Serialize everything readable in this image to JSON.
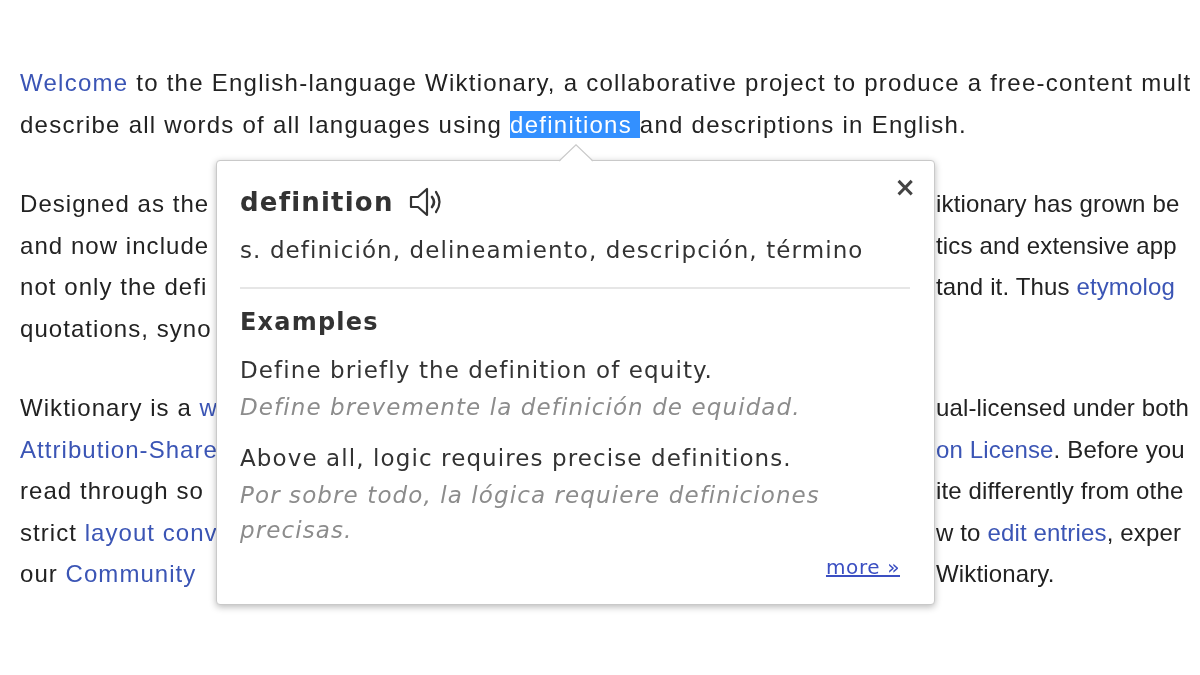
{
  "article": {
    "paragraphs": [
      {
        "lines": [
          {
            "kind": "whole",
            "left": [
              {
                "kind": "link",
                "text": "Welcome"
              },
              {
                "kind": "plain",
                "text": " to the English-language Wiktionary, a collaborative project to produce a free-content mult"
              }
            ]
          },
          {
            "kind": "whole",
            "left": [
              {
                "kind": "plain",
                "text": "describe all words of all languages using "
              },
              {
                "kind": "highlight",
                "text": "definitions "
              },
              {
                "kind": "plain",
                "text": "and descriptions in English."
              }
            ]
          }
        ]
      },
      {
        "lines": [
          {
            "kind": "split",
            "left": [
              {
                "kind": "plain",
                "text": "Designed as the"
              }
            ],
            "right": [
              {
                "kind": "plain",
                "text": "iktionary has grown be"
              }
            ]
          },
          {
            "kind": "split",
            "left": [
              {
                "kind": "plain",
                "text": "and now include"
              }
            ],
            "right": [
              {
                "kind": "plain",
                "text": "tics and extensive app"
              }
            ]
          },
          {
            "kind": "split",
            "left": [
              {
                "kind": "plain",
                "text": "not only the defi"
              }
            ],
            "right": [
              {
                "kind": "plain",
                "text": "tand it. Thus "
              },
              {
                "kind": "link",
                "text": "etymolog"
              }
            ]
          },
          {
            "kind": "split",
            "left": [
              {
                "kind": "plain",
                "text": "quotations, syno"
              }
            ]
          }
        ]
      },
      {
        "lines": [
          {
            "kind": "split",
            "left": [
              {
                "kind": "plain",
                "text": "Wiktionary is a "
              },
              {
                "kind": "link",
                "text": "w"
              }
            ],
            "right": [
              {
                "kind": "plain",
                "text": "ual-licensed under both"
              }
            ]
          },
          {
            "kind": "split",
            "left": [
              {
                "kind": "link",
                "text": "Attribution-Share"
              }
            ],
            "right": [
              {
                "kind": "link",
                "text": "on License"
              },
              {
                "kind": "plain",
                "text": ". Before you"
              }
            ]
          },
          {
            "kind": "split",
            "left": [
              {
                "kind": "plain",
                "text": "read through so"
              }
            ],
            "right": [
              {
                "kind": "plain",
                "text": "ite differently from othe"
              }
            ]
          },
          {
            "kind": "split",
            "left": [
              {
                "kind": "plain",
                "text": "strict "
              },
              {
                "kind": "link",
                "text": "layout conv"
              }
            ],
            "right": [
              {
                "kind": "plain",
                "text": "w to "
              },
              {
                "kind": "link",
                "text": "edit entries"
              },
              {
                "kind": "plain",
                "text": ", exper"
              }
            ]
          },
          {
            "kind": "split",
            "left": [
              {
                "kind": "plain",
                "text": "our "
              },
              {
                "kind": "link",
                "text": "Community"
              }
            ],
            "right": [
              {
                "kind": "plain",
                "text": "Wiktionary."
              }
            ]
          }
        ]
      }
    ]
  },
  "popup": {
    "close": "×",
    "headword": "definition",
    "translation": "s. definición, delineamiento, descripción, término",
    "examples_heading": "Examples",
    "examples": [
      {
        "sentence": "Define briefly the definition of equity.",
        "translation": "Define brevemente la definición de equidad."
      },
      {
        "sentence": "Above all, logic requires precise definitions.",
        "translation": "Por sobre todo, la lógica requiere definiciones precisas."
      }
    ],
    "more_link": "more »"
  }
}
